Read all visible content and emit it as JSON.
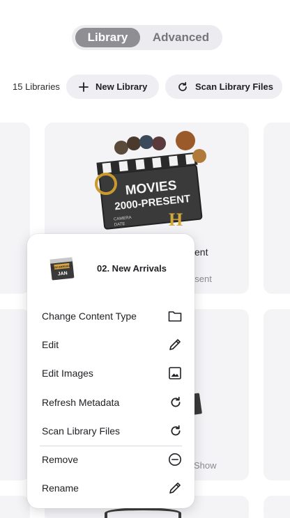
{
  "mode_switch": {
    "library_label": "Library",
    "advanced_label": "Advanced",
    "selected": "Library"
  },
  "toolbar": {
    "library_count": "15 Libraries",
    "new_library_label": "New Library",
    "scan_files_label": "Scan Library Files"
  },
  "cards": {
    "visible_title_fragment": "sent",
    "visible_subtitle_fragment": "esent",
    "second_row_subtitle_fragment": "Show",
    "poster_text": {
      "line1": "MOVIES",
      "line2": "2000-PRESENT",
      "field1": "CAMERA",
      "field2": "DATE"
    }
  },
  "context_menu": {
    "title": "02. New Arrivals",
    "thumb_text": {
      "line1": "NEW ARRIVALS",
      "line2": "JAN"
    },
    "items": [
      {
        "label": "Change Content Type",
        "icon": "folder-icon"
      },
      {
        "label": "Edit",
        "icon": "pencil-icon"
      },
      {
        "label": "Edit Images",
        "icon": "image-icon"
      },
      {
        "label": "Refresh Metadata",
        "icon": "refresh-icon"
      },
      {
        "label": "Scan Library Files",
        "icon": "refresh-icon"
      },
      {
        "label": "Remove",
        "icon": "minus-circle-icon"
      },
      {
        "label": "Rename",
        "icon": "pencil-icon"
      }
    ]
  },
  "colors": {
    "active_segment": "#8e8e93",
    "pill_background": "#eeeef3",
    "card_background": "#f4f4f7",
    "text_primary": "#1f1f24",
    "text_muted": "#8a8a90"
  }
}
